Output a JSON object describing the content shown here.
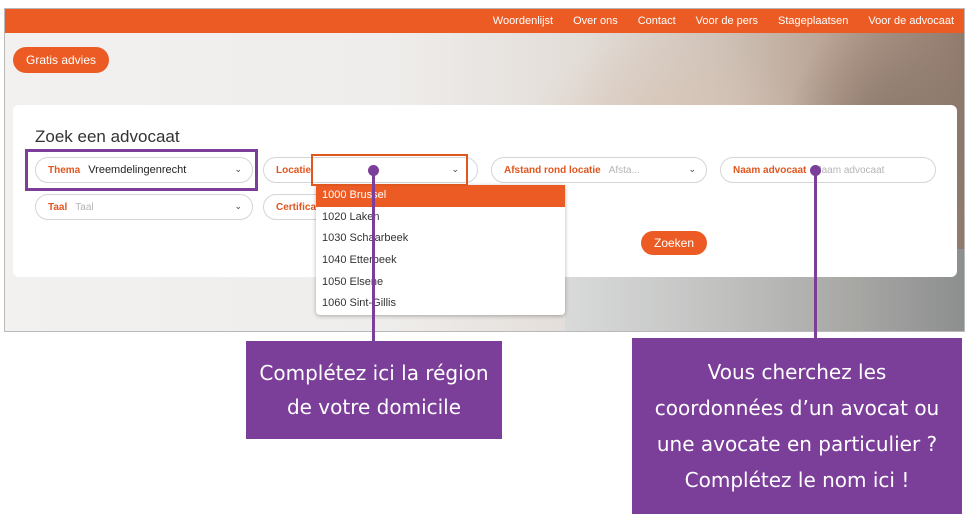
{
  "nav": {
    "items": [
      "Woordenlijst",
      "Over ons",
      "Contact",
      "Voor de pers",
      "Stageplaatsen",
      "Voor de advocaat"
    ]
  },
  "advies_button": "Gratis advies",
  "search": {
    "title": "Zoek een advocaat",
    "thema": {
      "label": "Thema",
      "value": "Vreemdelingenrecht"
    },
    "locatie": {
      "label": "Locatie",
      "value": ""
    },
    "afstand": {
      "label": "Afstand rond locatie",
      "placeholder": "Afsta..."
    },
    "naam": {
      "label": "Naam advocaat",
      "placeholder": "Naam advocaat"
    },
    "taal": {
      "label": "Taal",
      "placeholder": "Taal"
    },
    "certificaat": {
      "label": "Certifica"
    },
    "submit": "Zoeken",
    "locatie_options": [
      "1000 Brussel",
      "1020 Laken",
      "1030 Schaarbeek",
      "1040 Etterbeek",
      "1050 Elsene",
      "1060 Sint-Gillis"
    ]
  },
  "callouts": {
    "left": [
      "Complétez ici la région",
      "de votre domicile"
    ],
    "right": [
      "Vous cherchez les",
      "coordonnées d’un avocat ou",
      "une avocate en particulier ?",
      "Complétez le nom ici !"
    ]
  },
  "colors": {
    "brand": "#ec5b24",
    "annotation": "#7b3f9a"
  }
}
